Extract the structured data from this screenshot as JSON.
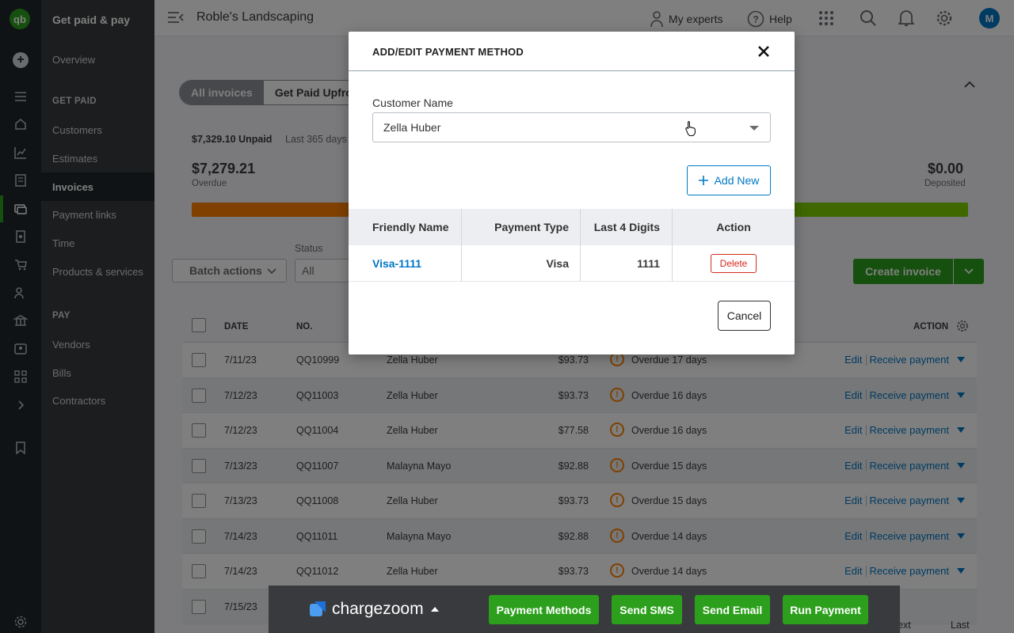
{
  "sidebar": {
    "title": "Get paid & pay",
    "overview": "Overview",
    "get_paid_section": "GET PAID",
    "get_paid_items": [
      "Customers",
      "Estimates",
      "Invoices",
      "Payment links",
      "Time",
      "Products & services"
    ],
    "pay_section": "PAY",
    "pay_items": [
      "Vendors",
      "Bills",
      "Contractors"
    ]
  },
  "rail": {
    "logo": "qb",
    "plus": "+"
  },
  "topbar": {
    "company": "Roble's Landscaping",
    "experts": "My experts",
    "help": "Help",
    "avatar": "M"
  },
  "main": {
    "tabs": [
      "All invoices",
      "Get Paid Upfro"
    ],
    "unpaid": "$7,329.10 Unpaid",
    "range": "Last 365 days",
    "overdue_amount": "$7,279.21",
    "overdue_label": "Overdue",
    "deposited_amount": "$0.00",
    "deposited_label": "Deposited",
    "batch_actions": "Batch actions",
    "status_label": "Status",
    "status_value": "All",
    "create_invoice": "Create invoice",
    "columns": {
      "date": "DATE",
      "no": "NO.",
      "action": "ACTION"
    },
    "edit": "Edit",
    "receive": "Receive payment",
    "rows": [
      {
        "date": "7/11/23",
        "no": "QQ10999",
        "customer": "Zella Huber",
        "amount": "$93.73",
        "status": "Overdue 17 days"
      },
      {
        "date": "7/12/23",
        "no": "QQ11003",
        "customer": "Zella Huber",
        "amount": "$93.73",
        "status": "Overdue 16 days"
      },
      {
        "date": "7/12/23",
        "no": "QQ11004",
        "customer": "Zella Huber",
        "amount": "$77.58",
        "status": "Overdue 16 days"
      },
      {
        "date": "7/13/23",
        "no": "QQ11007",
        "customer": "Malayna Mayo",
        "amount": "$92.88",
        "status": "Overdue 15 days"
      },
      {
        "date": "7/13/23",
        "no": "QQ11008",
        "customer": "Zella Huber",
        "amount": "$93.73",
        "status": "Overdue 15 days"
      },
      {
        "date": "7/14/23",
        "no": "QQ11011",
        "customer": "Malayna Mayo",
        "amount": "$92.88",
        "status": "Overdue 14 days"
      },
      {
        "date": "7/14/23",
        "no": "QQ11012",
        "customer": "Zella Huber",
        "amount": "$93.73",
        "status": "Overdue 14 days"
      },
      {
        "date": "7/15/23",
        "no": "",
        "customer": "",
        "amount": "",
        "status": ""
      }
    ],
    "pager_next": "ext",
    "pager_last": "Last"
  },
  "modal": {
    "title": "ADD/EDIT PAYMENT METHOD",
    "customer_label": "Customer Name",
    "customer_value": "Zella Huber",
    "add_new": "Add New",
    "columns": [
      "Friendly Name",
      "Payment Type",
      "Last 4 Digits",
      "Action"
    ],
    "rows": [
      {
        "friendly_name": "Visa-1111",
        "payment_type": "Visa",
        "last4": "1111",
        "action": "Delete"
      }
    ],
    "cancel": "Cancel"
  },
  "chargezoom": {
    "brand": "chargezoom",
    "buttons": [
      "Payment Methods",
      "Send SMS",
      "Send Email",
      "Run Payment"
    ]
  },
  "colors": {
    "green": "#2ca01c",
    "blue": "#0077c5",
    "danger": "#d52b1e",
    "overdue": "#ff8000"
  }
}
